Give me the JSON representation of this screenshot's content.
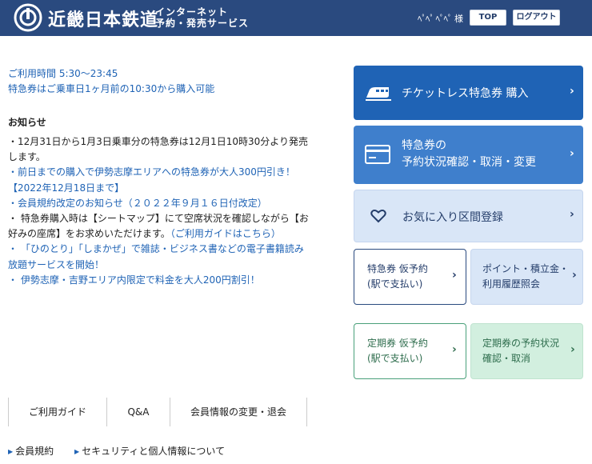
{
  "header": {
    "brand": "近畿日本鉄道",
    "sub_line1": "インターネット",
    "sub_line2": "予約・発売サービス",
    "user_masked": "ﾍﾟﾍﾟ ﾍﾟﾍﾟ",
    "user_suffix": "様",
    "top_button": "TOP",
    "logout_button": "ログアウト"
  },
  "info": {
    "hours": "ご利用時間 5:30〜23:45",
    "purchase_note": "特急券はご乗車日1ヶ月前の10:30から購入可能"
  },
  "notices": {
    "title": "お知らせ",
    "item1": "・12月31日から1月3日乗車分の特急券は12月1日10時30分より発売します。",
    "item2": "・前日までの購入で伊勢志摩エリアへの特急券が大人300円引き！【2022年12月18日まで】",
    "item3": "・会員規約改定のお知らせ（２０２２年９月１６日付改定）",
    "item4_pre": "・ 特急券購入時は【シートマップ】にて空席状況を確認しながら【お好みの座席】をお求めいただけます。",
    "item4_link": "（ご利用ガイドはこちら）",
    "item5": "・ 「ひのとり」「しまかぜ」で雑誌・ビジネス書などの電子書籍読み放題サービスを開始！",
    "item6": "・ 伊勢志摩・吉野エリア内限定で料金を大人200円割引！"
  },
  "cards": {
    "ticketless": "チケットレス特急券 購入",
    "status_line1": "特急券の",
    "status_line2": "予約状況確認・取消・変更",
    "favorites": "お気に入り区間登録",
    "kari_line1": "特急券 仮予約",
    "kari_line2": "(駅で支払い)",
    "point_line1": "ポイント・積立金・",
    "point_line2": "利用履歴照会",
    "teiki_line1": "定期券 仮予約",
    "teiki_line2": "(駅で支払い)",
    "teiki_status_line1": "定期券の予約状況",
    "teiki_status_line2": "確認・取消",
    "chevron": "›"
  },
  "footer": {
    "guide": "ご利用ガイド",
    "qa": "Q&A",
    "member": "会員情報の変更・退会",
    "terms": "会員規約",
    "security": "セキュリティと個人情報について"
  },
  "colors": {
    "header_bg": "#2a4a7f",
    "link": "#1f63b5",
    "primary_card": "#1f63b5",
    "secondary_card": "#3f7fcc",
    "light_card": "#d9e6f7",
    "green_card": "#d2efdf"
  }
}
